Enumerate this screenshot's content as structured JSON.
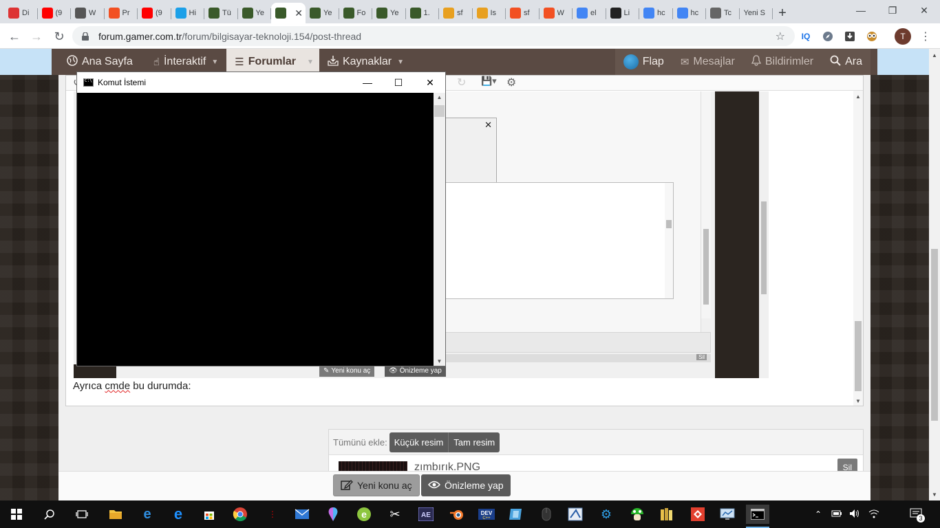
{
  "browser": {
    "tabs": [
      {
        "icon": "brand-1k-icon",
        "label": "Di",
        "color": "#d33"
      },
      {
        "icon": "youtube-icon",
        "label": "(9",
        "color": "#f00"
      },
      {
        "icon": "globe-icon",
        "label": "W",
        "color": "#555"
      },
      {
        "icon": "microsoft-icon",
        "label": "Pr",
        "color": "#f25022"
      },
      {
        "icon": "youtube-icon",
        "label": "(9",
        "color": "#f00"
      },
      {
        "icon": "w-brand-icon",
        "label": "Hi",
        "color": "#1ca0e8"
      },
      {
        "icon": "shield-icon",
        "label": "Tü",
        "color": "#3a5a2a"
      },
      {
        "icon": "shield-icon",
        "label": "Ye",
        "color": "#3a5a2a"
      },
      {
        "icon": "shield-icon",
        "label": "",
        "color": "#3a5a2a"
      },
      {
        "icon": "shield-icon",
        "label": "Ye",
        "color": "#3a5a2a"
      },
      {
        "icon": "shield-icon",
        "label": "Fo",
        "color": "#3a5a2a"
      },
      {
        "icon": "shield-icon",
        "label": "Ye",
        "color": "#3a5a2a"
      },
      {
        "icon": "shield-icon",
        "label": "1.",
        "color": "#3a5a2a"
      },
      {
        "icon": "rainbow-icon",
        "label": "sf",
        "color": "#e8a020"
      },
      {
        "icon": "rainbow-icon",
        "label": "Is",
        "color": "#e8a020"
      },
      {
        "icon": "microsoft-icon",
        "label": "sf",
        "color": "#f25022"
      },
      {
        "icon": "microsoft-icon",
        "label": "W",
        "color": "#f25022"
      },
      {
        "icon": "google-icon",
        "label": "el",
        "color": "#4285f4"
      },
      {
        "icon": "wikipedia-icon",
        "label": "Li",
        "color": "#222"
      },
      {
        "icon": "google-icon",
        "label": "hc",
        "color": "#4285f4"
      },
      {
        "icon": "google-icon",
        "label": "hc",
        "color": "#4285f4"
      },
      {
        "icon": "info-icon",
        "label": "Tc",
        "color": "#666"
      },
      {
        "icon": "",
        "label": "Yeni S",
        "color": "#888"
      }
    ],
    "active_tab_index": 8,
    "url_host": "forum.gamer.com.tr",
    "url_path": "/forum/bilgisayar-teknoloji.154/post-thread",
    "profile_initial": "T",
    "extensions": [
      "IQ"
    ]
  },
  "forum_nav": {
    "items": [
      {
        "label": "Ana Sayfa",
        "icon": "globe-icon"
      },
      {
        "label": "İnteraktif",
        "icon": "pointer-icon"
      },
      {
        "label": "Forumlar",
        "icon": "menu-icon"
      },
      {
        "label": "Kaynaklar",
        "icon": "download-tray-icon"
      }
    ],
    "right_items": [
      {
        "label": "Flap"
      },
      {
        "label": "Mesajlar"
      },
      {
        "label": "Bildirimler"
      },
      {
        "label": "Ara"
      }
    ]
  },
  "post": {
    "body_prefix": "Ayrıca ",
    "body_misspelled": "cmde",
    "body_suffix": " bu durumda:"
  },
  "embedded_screenshot": {
    "new_thread_label": "Yeni konu aç",
    "preview_label": "Önizleme yap",
    "delete_label": "Sil"
  },
  "attachments": {
    "insert_all_label": "Tümünü ekle:",
    "small_image_label": "Küçük resim",
    "full_image_label": "Tam resim",
    "file_name": "zımbırık.PNG",
    "delete_label": "Sil"
  },
  "form_buttons": {
    "new_thread": "Yeni konu aç",
    "preview": "Önizleme yap"
  },
  "cmd_window": {
    "title": "Komut İstemi"
  },
  "taskbar": {
    "notification_count": "3"
  }
}
